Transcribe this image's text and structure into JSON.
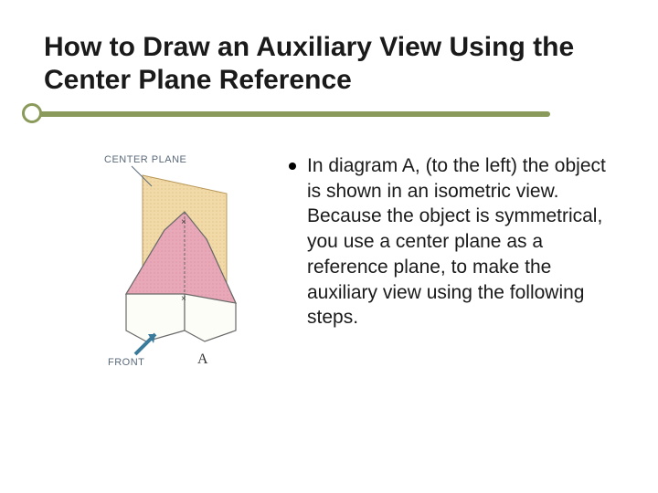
{
  "title": "How to Draw an Auxiliary View Using the Center Plane Reference",
  "diagram": {
    "label_center_plane": "CENTER PLANE",
    "label_front": "FRONT",
    "figure_label": "A"
  },
  "bullets": [
    "In diagram A, (to the left) the object is shown in an isometric view. Because the object is symmetrical, you use a center plane as a reference plane, to make the auxiliary view using the following steps."
  ]
}
